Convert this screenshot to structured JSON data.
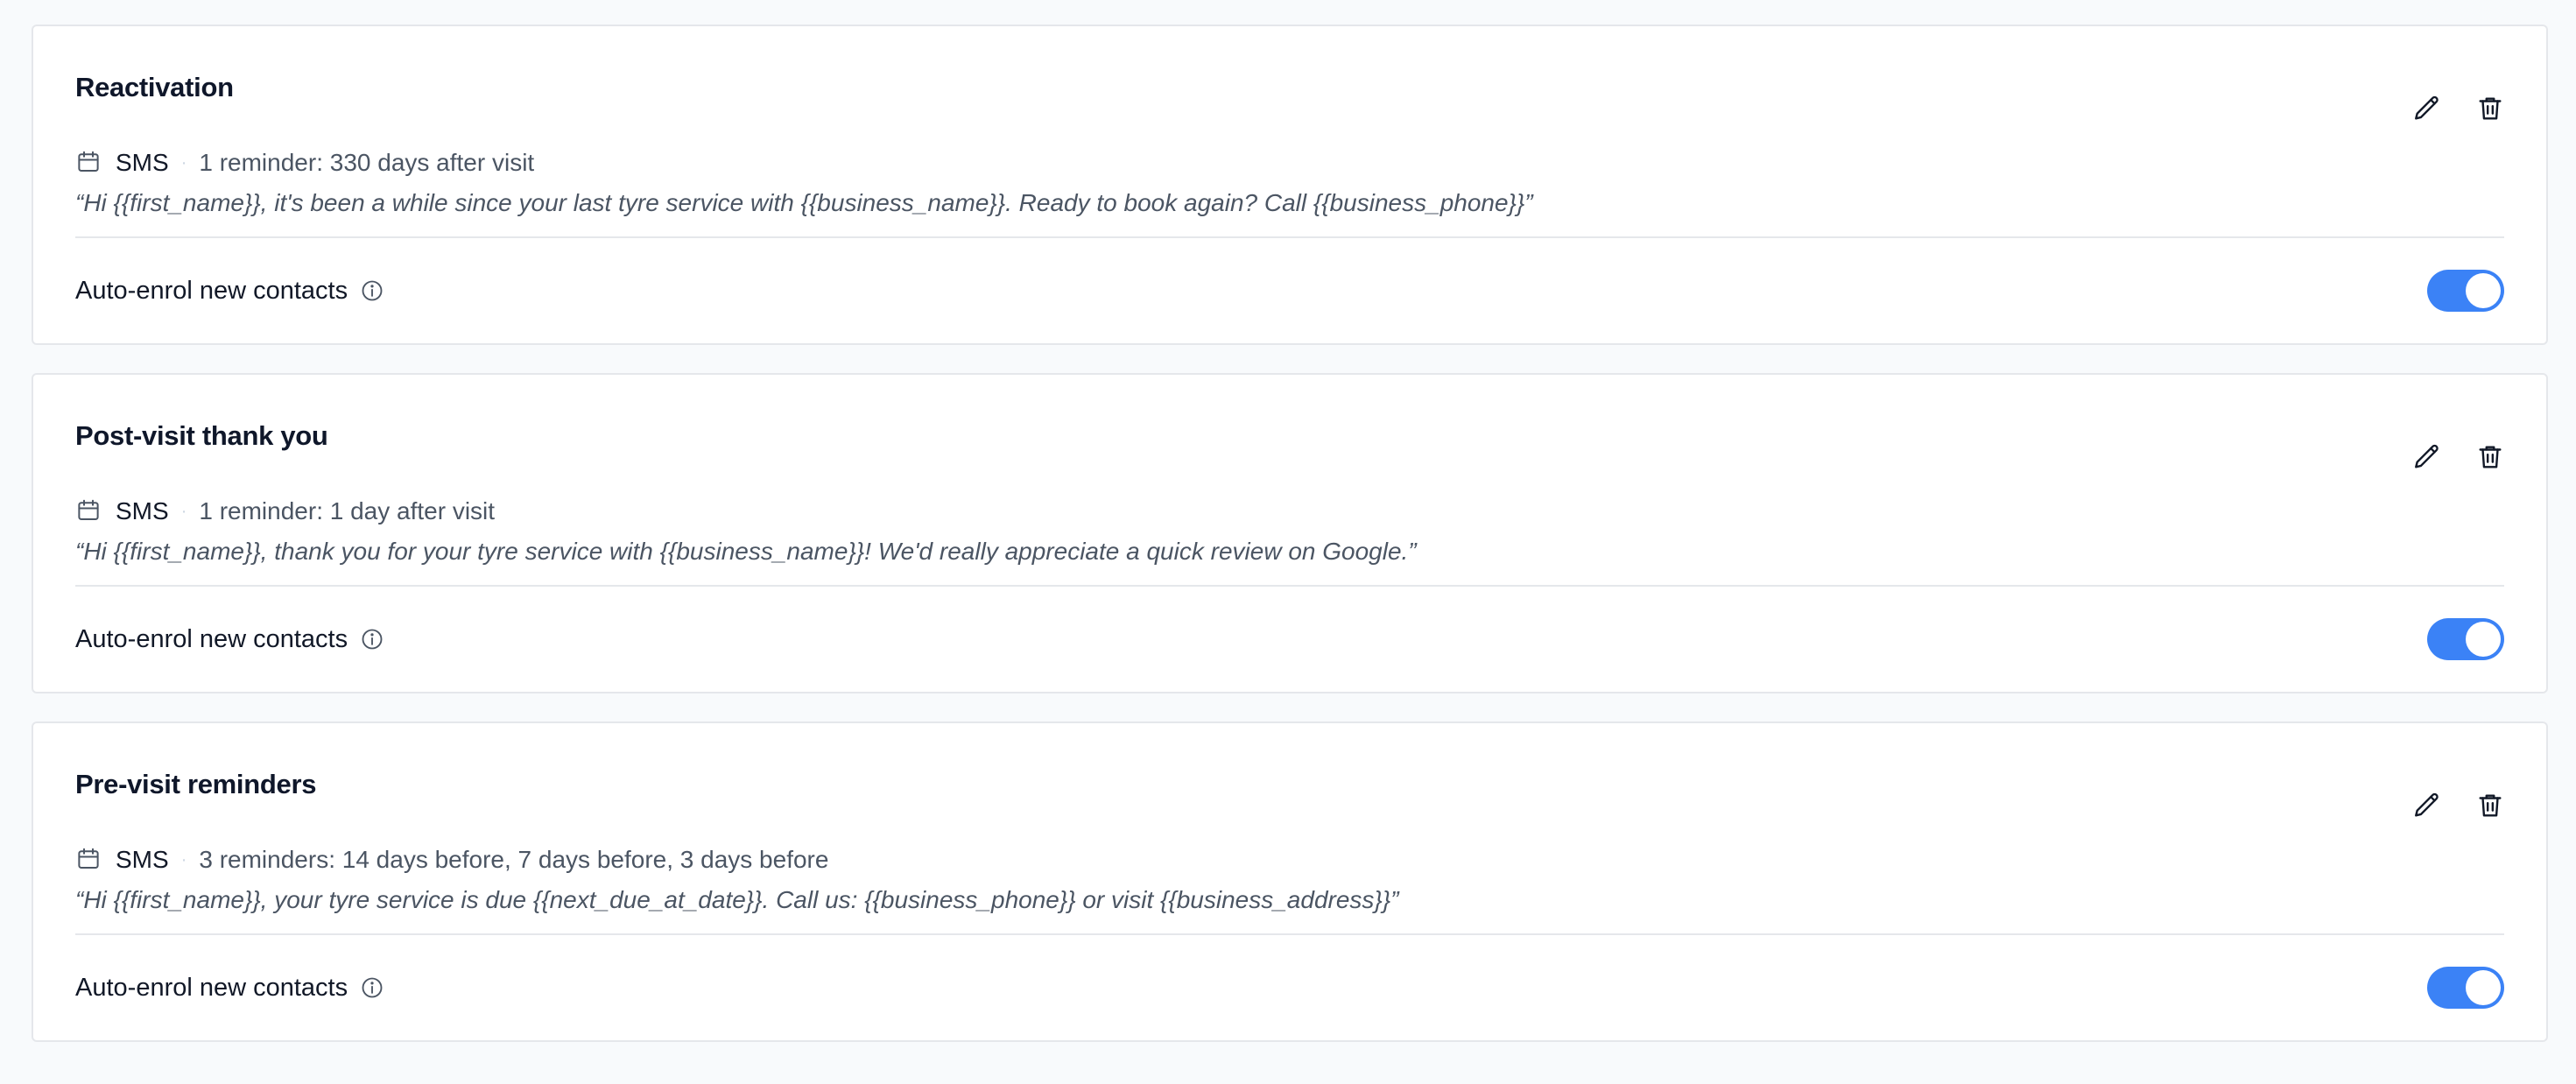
{
  "colors": {
    "accent": "#3b82f6",
    "card_background": "#ffffff",
    "page_background": "#f8fafc",
    "border": "#e5e7eb"
  },
  "campaigns": [
    {
      "title": "Reactivation",
      "channel": "SMS",
      "schedule": "1 reminder: 330 days after visit",
      "message": "“Hi {{first_name}}, it's been a while since your last tyre service with {{business_name}}. Ready to book again? Call {{business_phone}}”",
      "auto_enrol_label": "Auto-enrol new contacts",
      "auto_enrol_enabled": true,
      "icons": {
        "channel": "calendar-icon",
        "edit": "pencil-icon",
        "delete": "trash-icon",
        "info": "info-icon"
      }
    },
    {
      "title": "Post-visit thank you",
      "channel": "SMS",
      "schedule": "1 reminder: 1 day after visit",
      "message": "“Hi {{first_name}}, thank you for your tyre service with {{business_name}}! We'd really appreciate a quick review on Google.”",
      "auto_enrol_label": "Auto-enrol new contacts",
      "auto_enrol_enabled": true,
      "icons": {
        "channel": "calendar-icon",
        "edit": "pencil-icon",
        "delete": "trash-icon",
        "info": "info-icon"
      }
    },
    {
      "title": "Pre-visit reminders",
      "channel": "SMS",
      "schedule": "3 reminders: 14 days before, 7 days before, 3 days before",
      "message": "“Hi {{first_name}}, your tyre service is due {{next_due_at_date}}. Call us: {{business_phone}} or visit {{business_address}}”",
      "auto_enrol_label": "Auto-enrol new contacts",
      "auto_enrol_enabled": true,
      "icons": {
        "channel": "calendar-icon",
        "edit": "pencil-icon",
        "delete": "trash-icon",
        "info": "info-icon"
      }
    }
  ]
}
